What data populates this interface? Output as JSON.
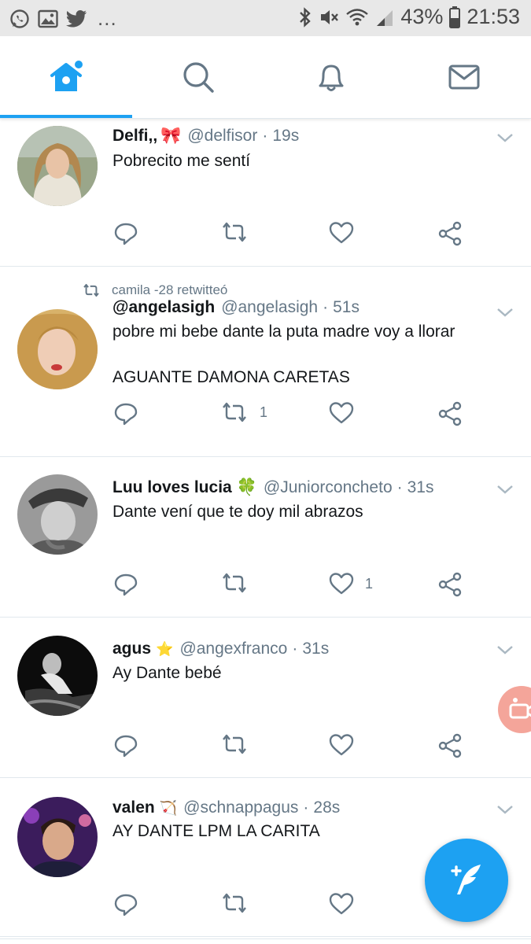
{
  "status_bar": {
    "left_icons": [
      "whatsapp-icon",
      "gallery-icon",
      "twitter-icon"
    ],
    "more": "...",
    "battery": "43%",
    "time": "21:53"
  },
  "nav": {
    "tabs": [
      {
        "name": "home",
        "icon": "home-icon",
        "active": true
      },
      {
        "name": "search",
        "icon": "search-icon",
        "active": false
      },
      {
        "name": "notifications",
        "icon": "bell-icon",
        "active": false
      },
      {
        "name": "messages",
        "icon": "mail-icon",
        "active": false
      }
    ],
    "accent": "#1da1f2"
  },
  "tweets": [
    {
      "name": "Delfi,,",
      "emoji": "🎀",
      "handle": "@delfisor",
      "time": "19s",
      "text": [
        "Pobrecito me sentí"
      ],
      "retweeted_by": "",
      "retweet_count": "",
      "like_count": ""
    },
    {
      "name": "@angelasigh",
      "emoji": "",
      "handle": "@angelasigh",
      "time": "51s",
      "text": [
        "pobre mi bebe dante la puta madre voy a llorar",
        "",
        "AGUANTE DAMONA CARETAS"
      ],
      "retweeted_by": "camila -28 retwitteó",
      "retweet_count": "1",
      "like_count": ""
    },
    {
      "name": "Luu loves lucia",
      "emoji": "🍀",
      "handle": "@Juniorconcheto",
      "time": "31s",
      "text": [
        "Dante vení que te doy mil abrazos"
      ],
      "retweeted_by": "",
      "retweet_count": "",
      "like_count": "1"
    },
    {
      "name": "agus",
      "emoji": "⭐",
      "handle": "@angexfranco",
      "time": "31s",
      "text": [
        "Ay Dante bebé"
      ],
      "retweeted_by": "",
      "retweet_count": "",
      "like_count": ""
    },
    {
      "name": "valen",
      "emoji": "🏹",
      "handle": "@schnappagus",
      "time": "28s",
      "text": [
        "AY DANTE LPM LA CARITA"
      ],
      "retweeted_by": "",
      "retweet_count": "",
      "like_count": ""
    }
  ],
  "compose": {
    "icon": "compose-feather-icon"
  }
}
